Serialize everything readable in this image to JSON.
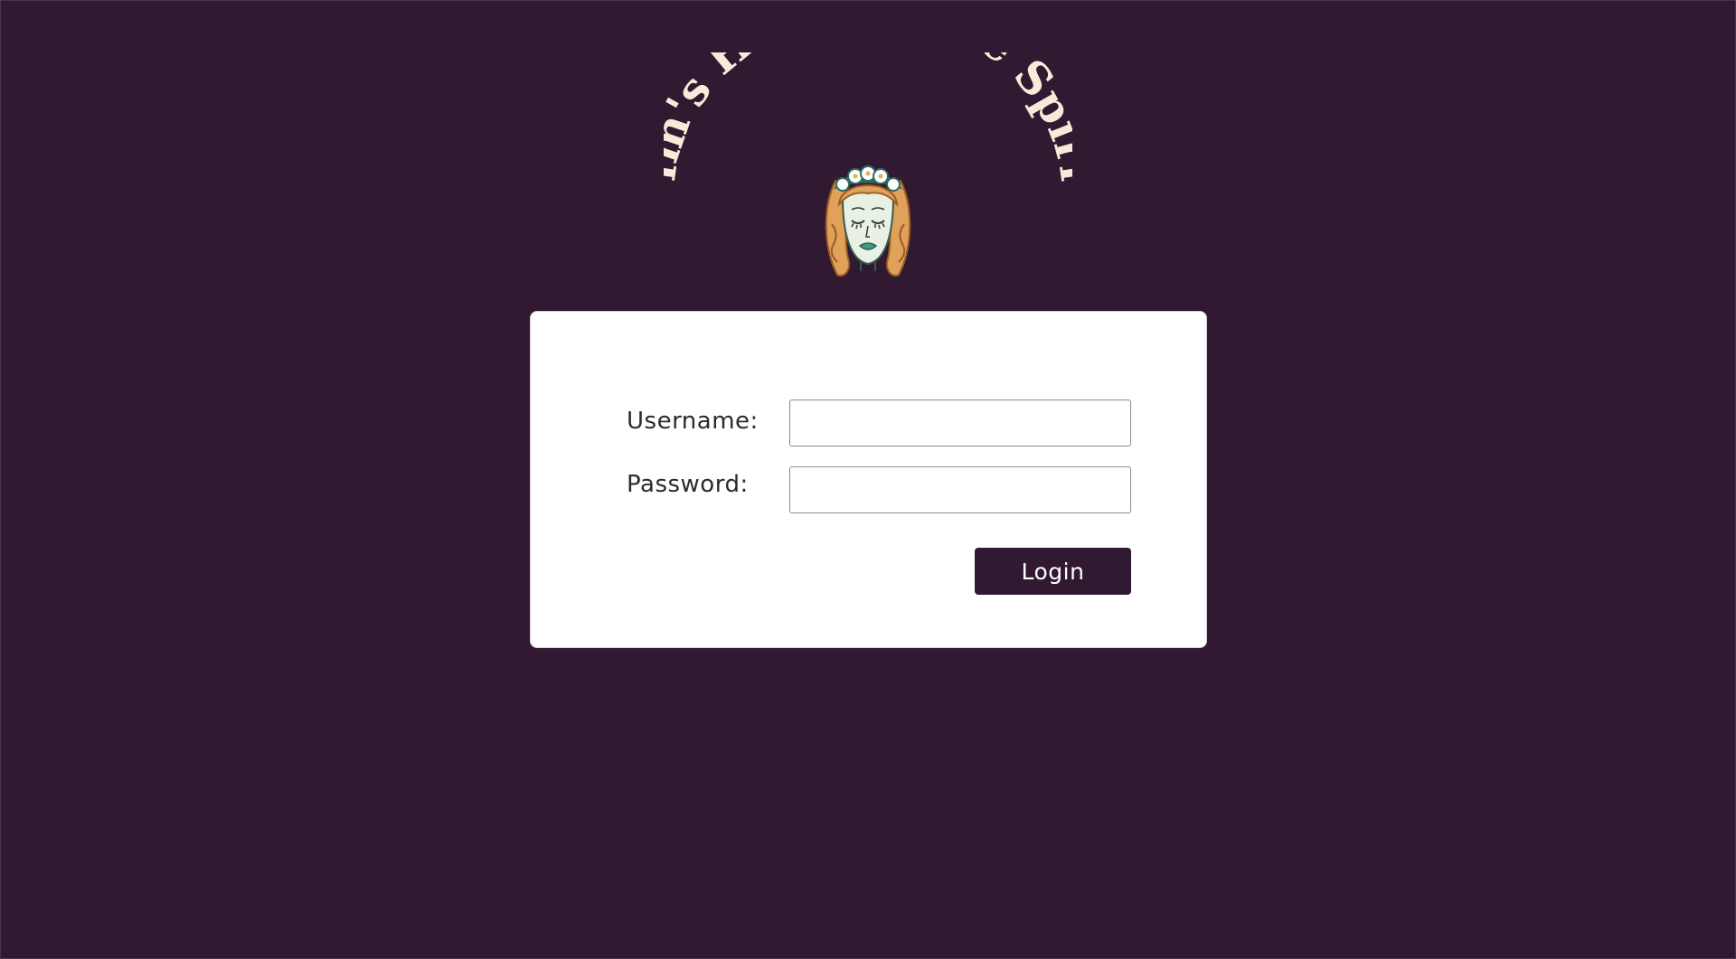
{
  "logo": {
    "title": "Jim's Healing The Spirit",
    "icon": "woman-face-flower-crown-icon"
  },
  "form": {
    "username_label": "Username:",
    "password_label": "Password:",
    "username_value": "",
    "password_value": "",
    "login_label": "Login"
  },
  "colors": {
    "background": "#311932",
    "card": "#ffffff",
    "button": "#311932",
    "logo_text": "#f6ead8"
  }
}
